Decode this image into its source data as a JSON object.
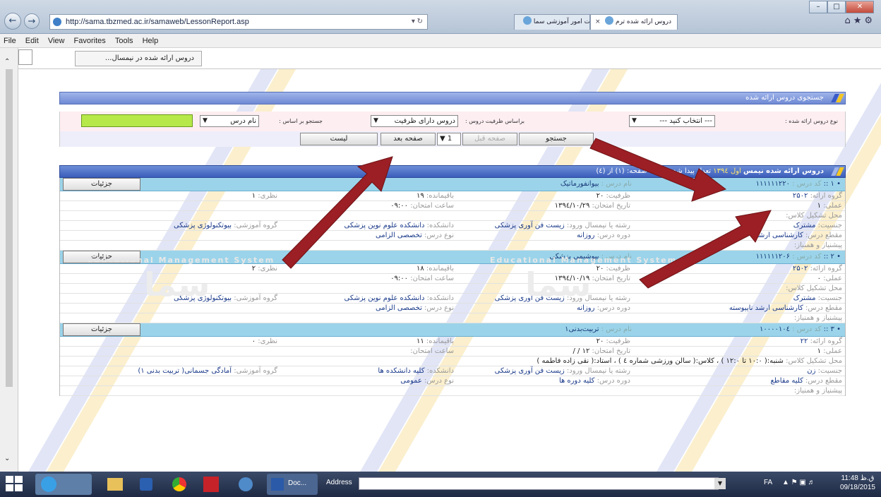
{
  "browser": {
    "url": "http://sama.tbzmed.ac.ir/samaweb/LessonReport.asp",
    "tab1_label": "سیستم مدیریت امور آموزشی سما",
    "tab2_label": "دروس ارائه شده ترم",
    "menu": [
      "File",
      "Edit",
      "View",
      "Favorites",
      "Tools",
      "Help"
    ],
    "frame_tab_label": "دروس ارائه شده در نیمسال..."
  },
  "search_panel": {
    "title": "جستجوی دروس ارائه شده",
    "offer_type_label": "نوع دروس ارائه شده :",
    "offer_type_value": "--- انتخاب کنید ---",
    "capacity_label": "براساس ظرفیت دروس :",
    "capacity_value": "دروس دارای ظرفیت",
    "search_by_label": "جستجو بر اساس :",
    "search_by_value": "نام درس",
    "search_button": "جستجو",
    "prev_button": "صفحه قبل",
    "page_value": "1",
    "next_button": "صفحه بعد",
    "list_button": "لیست"
  },
  "results": {
    "header_prefix": "دروس ارائه شده نیمس",
    "header_year": "اول ۱۳۹٤",
    "header_count": "تعداد پیدا شده (۱۱) ، صفحه: (۱) از (٤)"
  },
  "labels": {
    "code": "کد درس :",
    "name": "نام درس :",
    "details": "جزئیات",
    "group": "گروه ارائه:",
    "capacity": "ظرفیت:",
    "remaining": "باقیمانده:",
    "theory": "نظری:",
    "practical": "عملی:",
    "exam_date": "تاریخ امتحان:",
    "exam_time": "ساعت امتحان:",
    "location": "محل تشکیل کلاس:",
    "gender": "جنسیت:",
    "entry": "رشته یا نیمسال ورود:",
    "faculty": "دانشکده:",
    "dept": "گروه آموزشی:",
    "level": "مقطع درس:",
    "period": "دوره درس:",
    "course_type": "نوع درس:",
    "prereq": "پیشنیاز و همنیاز:"
  },
  "courses": [
    {
      "index": "۱",
      "code": "۱۱۱۱۱۱۲۲۰",
      "name": "بیوانفورماتیک",
      "group": "۲۵۰۲",
      "capacity": "۲۰",
      "remaining": "۱۹",
      "theory": "۱",
      "practical": "۱",
      "exam_date": "۱۳۹٤/۱۰/۲۹",
      "exam_time": "۰۹:۰۰",
      "location": "",
      "gender": "مشترک",
      "entry": "زیست فن آوری پزشکی",
      "faculty": "دانشکده علوم نوین پزشکی",
      "dept": "بیوتکنولوژی پزشکی",
      "level": "کارشناسی ارشد",
      "period": "روزانه",
      "course_type": "تخصصی الزامی"
    },
    {
      "index": "۲",
      "code": "۱۱۱۱۱۱۲۰۶",
      "name": "بیوشیمی پزشکی",
      "group": "۲۵۰۲",
      "capacity": "۲۰",
      "remaining": "۱۸",
      "theory": "۲",
      "practical": "۰",
      "exam_date": "۱۳۹٤/۱۰/۱۹",
      "exam_time": "۰۹:۰۰",
      "location": "",
      "gender": "مشترک",
      "entry": "زیست فن آوری پزشکی",
      "faculty": "دانشکده علوم نوین پزشکی",
      "dept": "بیوتکنولوژی پزشکی",
      "level": "کارشناسی ارشد ناپیوسته",
      "period": "روزانه",
      "course_type": "تخصصی الزامی"
    },
    {
      "index": "۳",
      "code": "۱۰۰۰۰۱۰٤",
      "name": "تربیت‌بدنی۱",
      "group": "۲۲",
      "capacity": "۲۰",
      "remaining": "۱۱",
      "theory": "۰",
      "practical": "۱",
      "exam_date": "۱۲ / /",
      "exam_time": "",
      "location": "شنبه:( ۱۰:۰ تا ۱۲:۰ ) ، کلاس:( سالن ورزشی شماره ٤ ) ، استاد:( نقی زاده فاطمه )",
      "gender": "زن",
      "entry": "زیست فن آوری پزشکی",
      "faculty": "کلیه دانشکده ها",
      "dept": "آمادگی جسمانی( تربیت بدنی ۱)",
      "level": "کلیه مقاطع",
      "period": "کلیه دوره ها",
      "course_type": "عمومی"
    }
  ],
  "watermark": {
    "text": "Educational Management System",
    "logo": "سما"
  },
  "taskbar": {
    "address_label": "Address",
    "doc_label": "Doc...",
    "lang": "FA",
    "time": "11:48 ق.ظ",
    "date": "09/18/2015"
  },
  "colors": {
    "header_blue": "#6f8ad4",
    "course_head": "#9bd4ea",
    "arrow": "#9b1f24"
  }
}
